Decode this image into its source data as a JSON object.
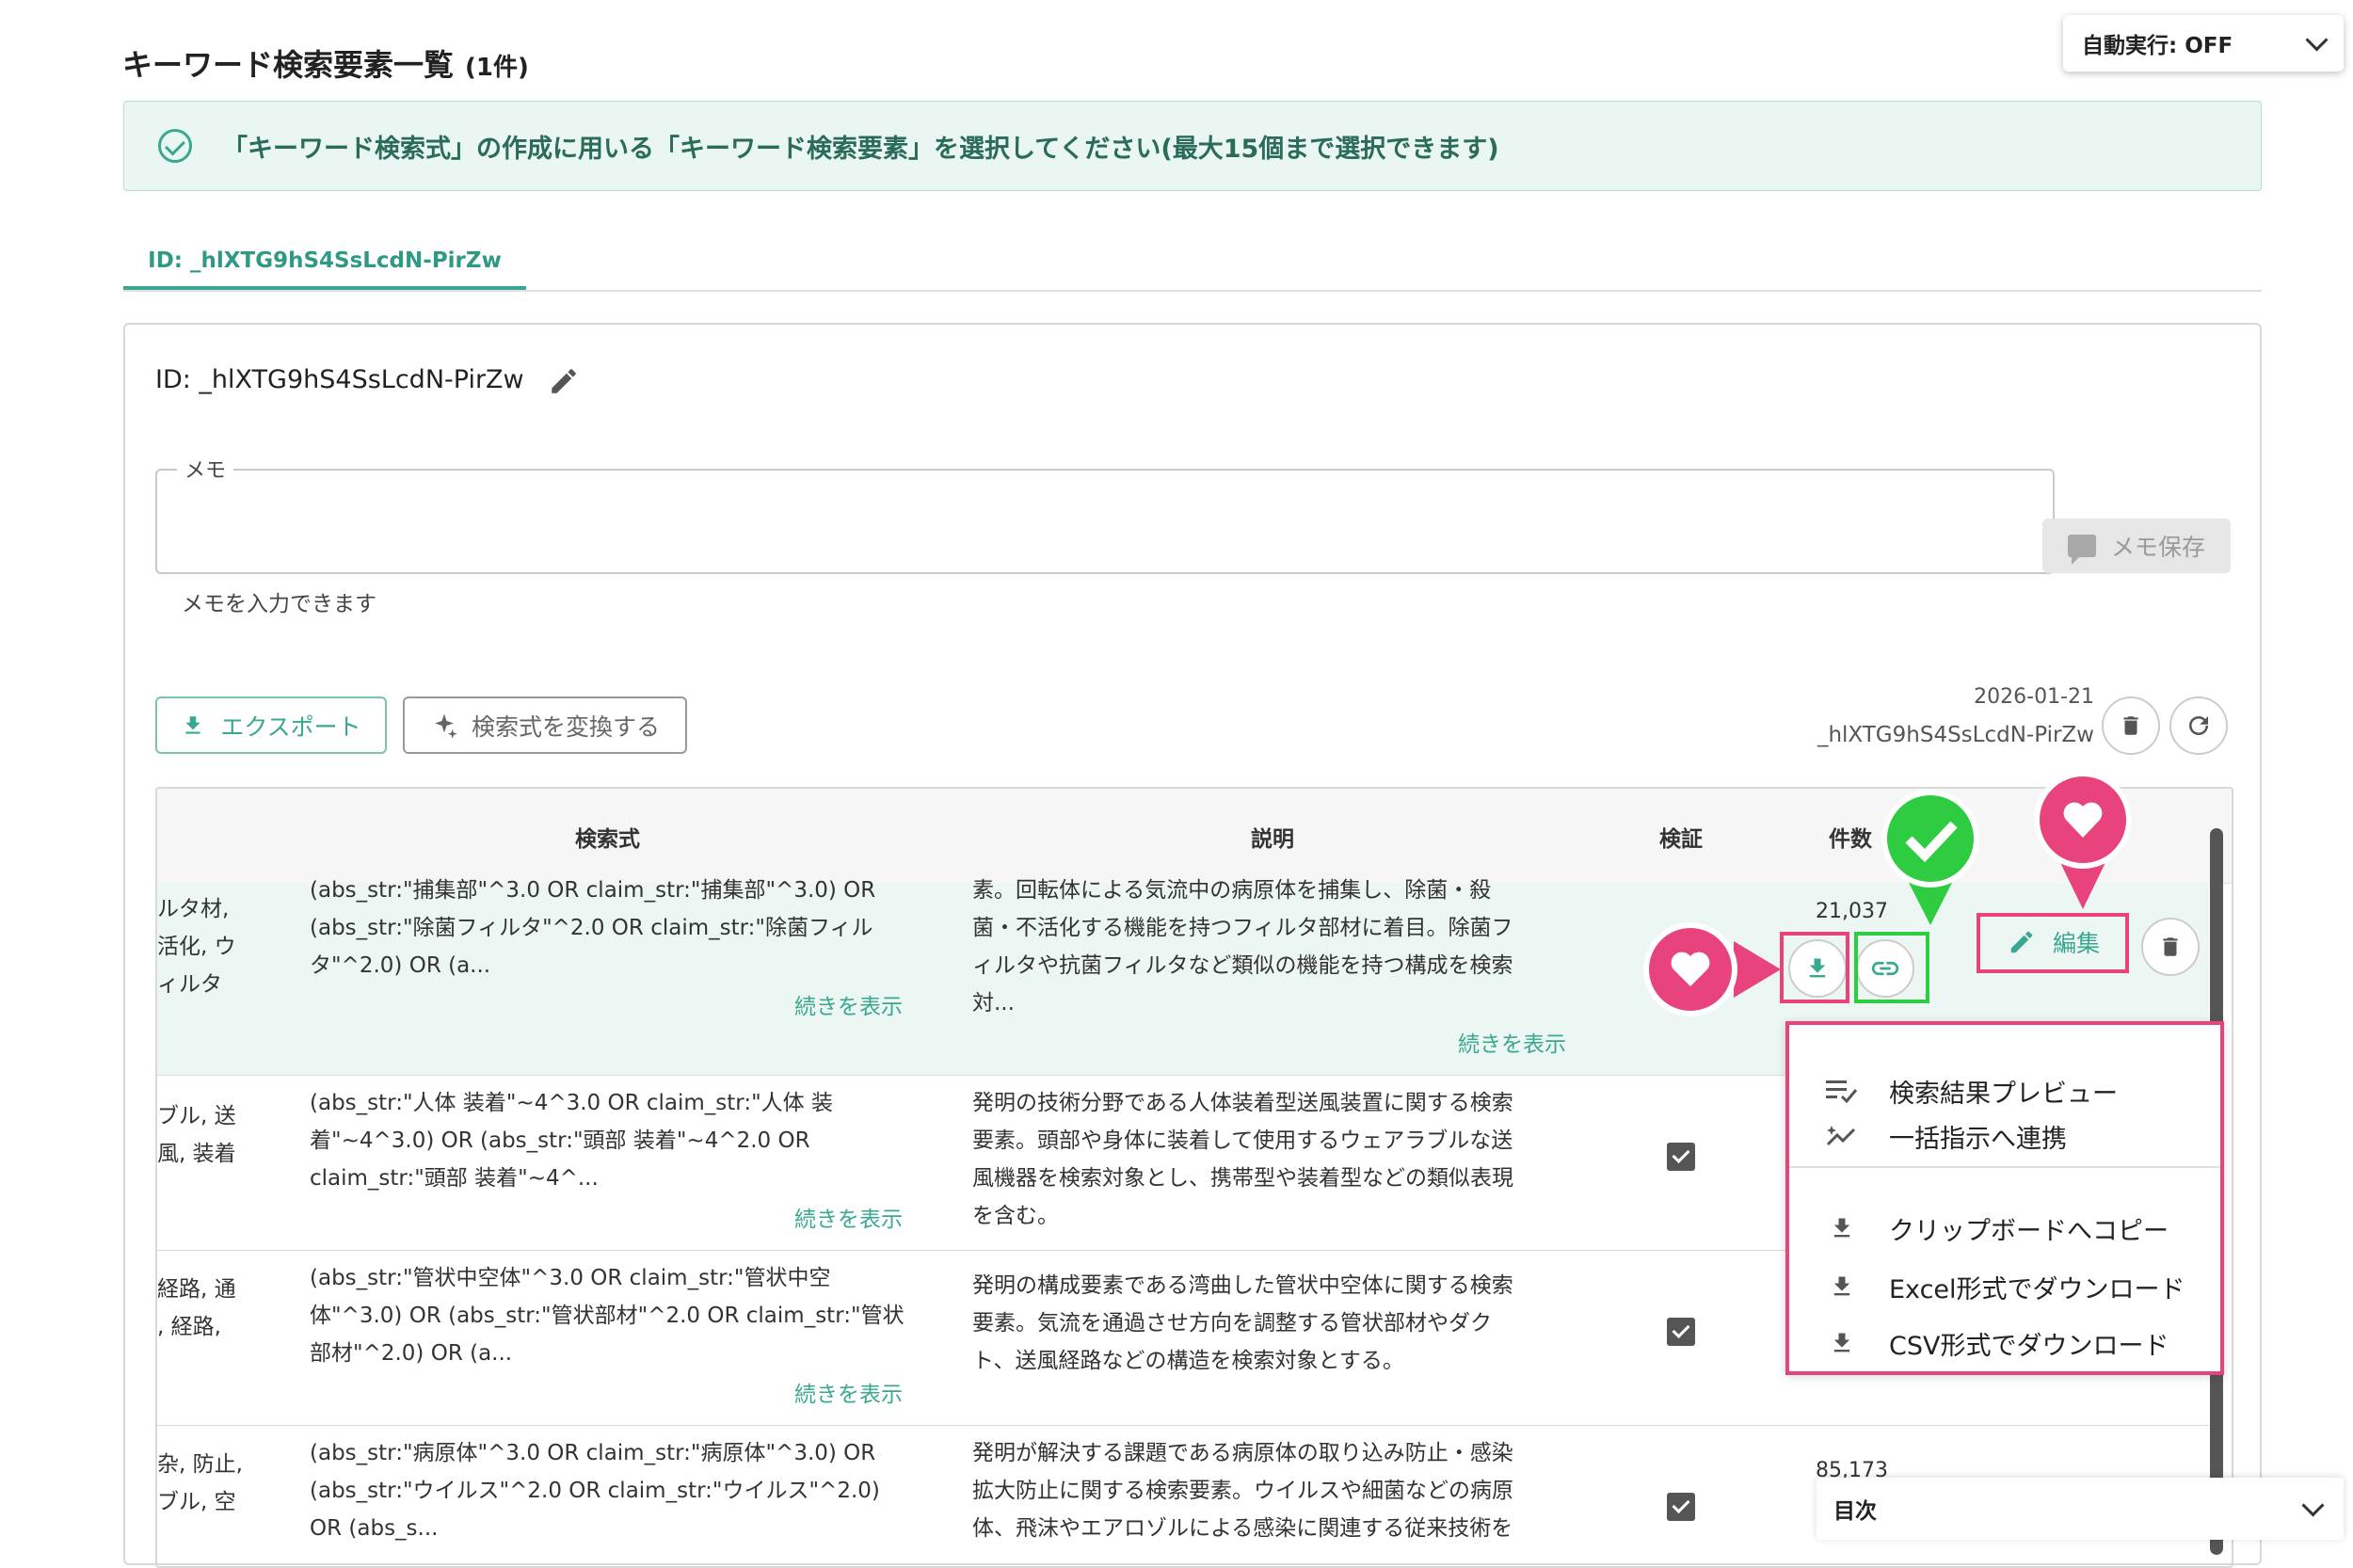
{
  "header": {
    "title": "キーワード検索要素一覧",
    "count": "(1件)"
  },
  "auto_run": {
    "label": "自動実行: OFF"
  },
  "info": {
    "message": "「キーワード検索式」の作成に用いる「キーワード検索要素」を選択してください(最大15個まで選択できます)"
  },
  "tab": {
    "label": "ID: _hlXTG9hS4SsLcdN-PirZw"
  },
  "card": {
    "id_label": "ID: _hlXTG9hS4SsLcdN-PirZw",
    "memo_label": "メモ",
    "memo_value": "",
    "memo_hint": "メモを入力できます",
    "memo_save": "メモ保存",
    "export": "エクスポート",
    "convert": "検索式を変換する",
    "date": "2026-01-21",
    "meta_id": "_hlXTG9hS4SsLcdN-PirZw"
  },
  "table": {
    "headers": {
      "query": "検索式",
      "desc": "説明",
      "verify": "検証",
      "count": "件数"
    },
    "more": "続きを表示",
    "rows": [
      {
        "kw": [
          "ルタ材,",
          "活化, ウ",
          "ィルタ"
        ],
        "query": [
          "(abs_str:\"捕集部\"^3.0 OR claim_str:\"捕集部\"^3.0) OR",
          "(abs_str:\"除菌フィルタ\"^2.0 OR claim_str:\"除菌フィル",
          "タ\"^2.0) OR (a..."
        ],
        "desc": [
          "素。回転体による気流中の病原体を捕集し、除菌・殺",
          "菌・不活化する機能を持つフィルタ部材に着目。除菌フ",
          "ィルタや抗菌フィルタなど類似の機能を持つ構成を検索",
          "対..."
        ],
        "count": "21,037"
      },
      {
        "kw": [
          "ブル, 送",
          "風, 装着"
        ],
        "query": [
          "(abs_str:\"人体 装着\"~4^3.0 OR claim_str:\"人体 装",
          "着\"~4^3.0) OR (abs_str:\"頭部 装着\"~4^2.0 OR",
          "claim_str:\"頭部 装着\"~4^..."
        ],
        "desc": [
          "発明の技術分野である人体装着型送風装置に関する検索",
          "要素。頭部や身体に装着して使用するウェアラブルな送",
          "風機器を検索対象とし、携帯型や装着型などの類似表現",
          "を含む。"
        ]
      },
      {
        "kw": [
          "経路, 通",
          ", 経路,"
        ],
        "query": [
          "(abs_str:\"管状中空体\"^3.0 OR claim_str:\"管状中空",
          "体\"^3.0) OR (abs_str:\"管状部材\"^2.0 OR claim_str:\"管状",
          "部材\"^2.0) OR (a..."
        ],
        "desc": [
          "発明の構成要素である湾曲した管状中空体に関する検索",
          "要素。気流を通過させ方向を調整する管状部材やダク",
          "ト、送風経路などの構造を検索対象とする。"
        ]
      },
      {
        "kw": [
          "杂, 防止,",
          "ブル, 空"
        ],
        "query": [
          "(abs_str:\"病原体\"^3.0 OR claim_str:\"病原体\"^3.0) OR",
          "(abs_str:\"ウイルス\"^2.0 OR claim_str:\"ウイルス\"^2.0)",
          "OR (abs_s..."
        ],
        "desc": [
          "発明が解決する課題である病原体の取り込み防止・感染",
          "拡大防止に関する検索要素。ウイルスや細菌などの病原",
          "体、飛沫やエアロゾルによる感染に関連する従来技術を"
        ],
        "count": "85,173"
      }
    ]
  },
  "actions": {
    "edit": "編集"
  },
  "menu": {
    "items": [
      "検索結果プレビュー",
      "一括指示へ連携",
      "クリップボードへコピー",
      "Excel形式でダウンロード",
      "CSV形式でダウンロード"
    ]
  },
  "toc": {
    "label": "目次"
  },
  "colors": {
    "accent": "#3aa891",
    "highlight_pink": "#e8437d",
    "highlight_green": "#2ecc40"
  }
}
